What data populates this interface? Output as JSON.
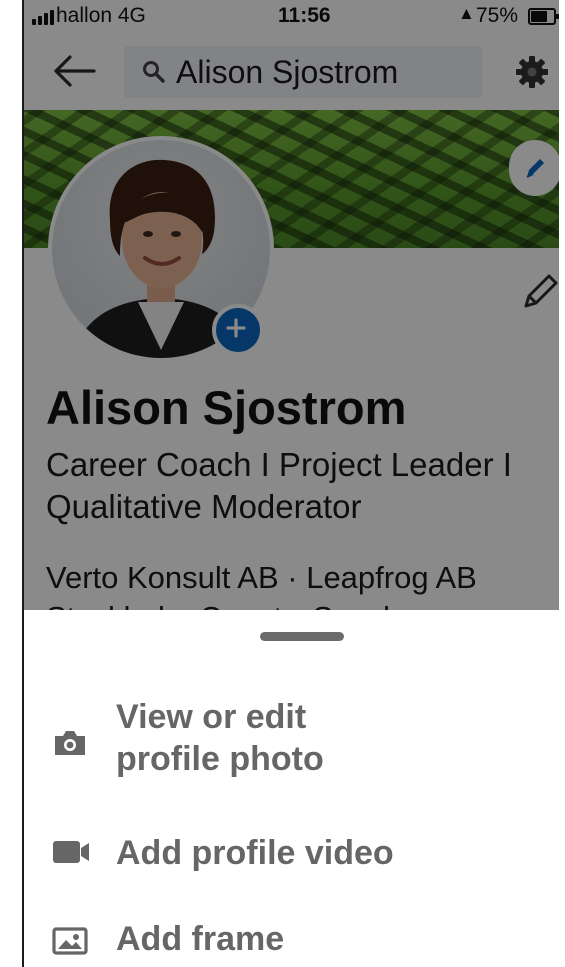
{
  "status_bar": {
    "carrier": "hallon  4G",
    "time": "11:56",
    "battery_percent": "75%",
    "icons": [
      "signal-icon",
      "person-icon",
      "battery-icon"
    ]
  },
  "header": {
    "search_text": "Alison Sjostrom",
    "icons": [
      "back-arrow-icon",
      "search-icon",
      "gear-icon"
    ]
  },
  "profile": {
    "name": "Alison Sjostrom",
    "headline": "Career Coach I Project Leader I Qualitative Moderator",
    "companies": "Verto Konsult AB · Leapfrog AB",
    "location": "Stockholm County, Sweden",
    "icons": [
      "pencil-icon",
      "plus-icon",
      "camera-icon"
    ]
  },
  "sheet": {
    "items": [
      {
        "label": "View or edit profile photo",
        "icon": "camera-icon"
      },
      {
        "label": "Add profile video",
        "icon": "video-camera-icon"
      },
      {
        "label": "Add frame",
        "icon": "image-frame-icon"
      }
    ]
  },
  "colors": {
    "accent": "#0a66c2",
    "sheet_text": "#666666",
    "overlay": "rgba(0,0,0,0.46)"
  }
}
